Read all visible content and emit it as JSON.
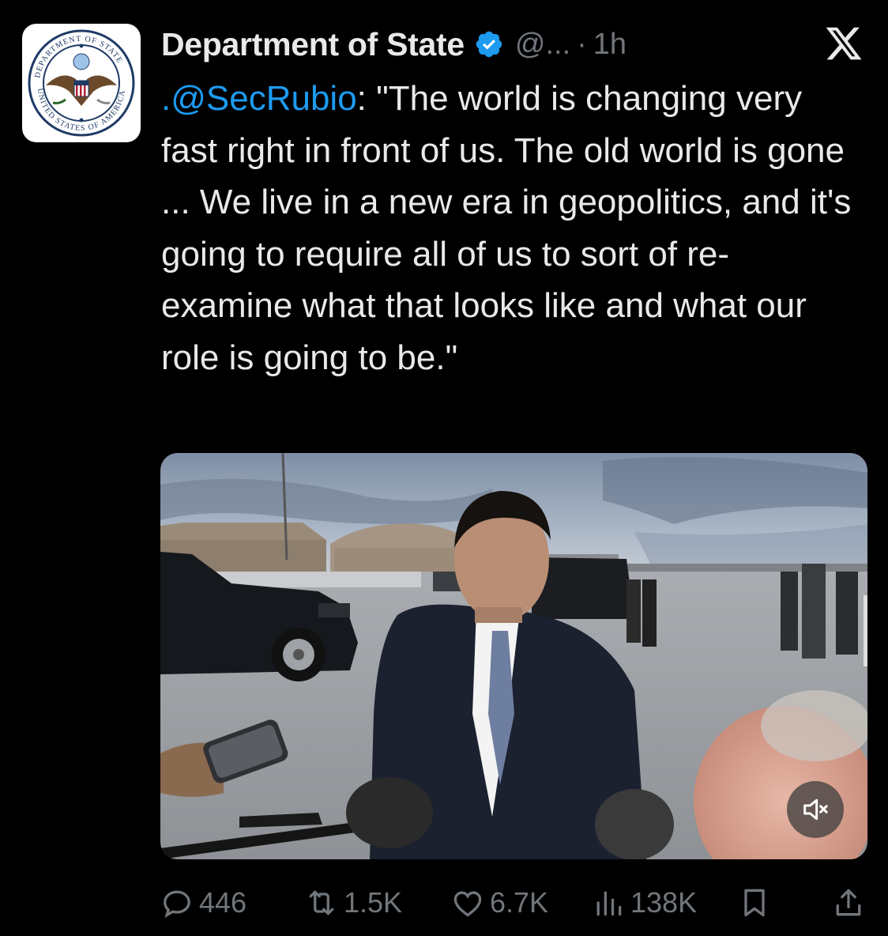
{
  "account": {
    "name": "Department of State",
    "handle": "@...",
    "separator": "·",
    "time": "1h",
    "avatar_icon": "us-department-of-state-seal-icon",
    "avatar_seal_text_top": "DEPARTMENT OF STATE",
    "avatar_seal_text_bottom": "UNITED STATES OF AMERICA"
  },
  "tweet": {
    "mention": ".@SecRubio",
    "body": ": \"The world is changing very fast right in front of us. The old world is gone ... We live in a new era in geopolitics, and it's going to require all of us to sort of re-examine what that looks like and what our role is going to be.\""
  },
  "actions": {
    "replies": "446",
    "reposts": "1.5K",
    "likes": "6.7K",
    "views": "138K"
  },
  "colors": {
    "background": "#000000",
    "text": "#e7e9ea",
    "secondary": "#71767b",
    "link": "#1d9bf0",
    "verified": "#1d9bf0"
  },
  "icons": [
    "verified-badge-icon",
    "x-logo-icon",
    "mute-icon",
    "reply-icon",
    "repost-icon",
    "like-icon",
    "views-icon",
    "bookmark-icon",
    "share-icon"
  ]
}
